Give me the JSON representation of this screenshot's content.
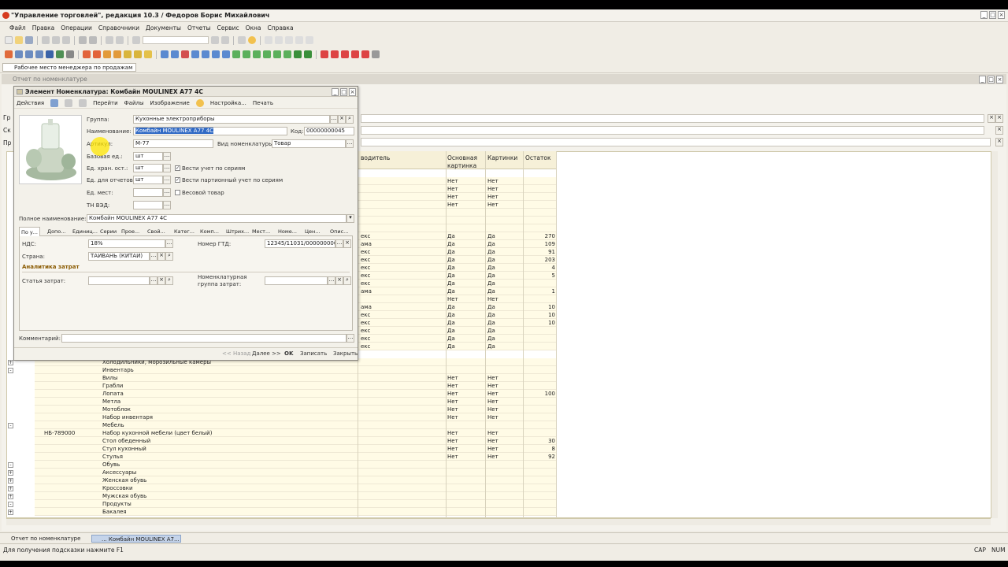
{
  "app": {
    "title": "\"Управление торговлей\", редакция 10.3 / Федоров Борис Михайлович",
    "window_buttons": [
      "_",
      "□",
      "×"
    ]
  },
  "menu": [
    "Файл",
    "Правка",
    "Операции",
    "Справочники",
    "Документы",
    "Отчеты",
    "Сервис",
    "Окна",
    "Справка"
  ],
  "panel": {
    "tab_label": "Рабочее место менеджера по продажам"
  },
  "report": {
    "title": "Отчет по номенклатуре",
    "left_labels": [
      "Гр",
      "Ск",
      "Пр"
    ],
    "columns": {
      "producer": "водитель",
      "main_picture": "Основная картинка",
      "pictures": "Картинки",
      "stock": "Остаток"
    },
    "rows_upper": [
      {
        "producer": "",
        "main": "Нет",
        "pics": "Нет",
        "stock": ""
      },
      {
        "producer": "",
        "main": "Нет",
        "pics": "Нет",
        "stock": ""
      },
      {
        "producer": "",
        "main": "Нет",
        "pics": "Нет",
        "stock": ""
      },
      {
        "producer": "",
        "main": "Нет",
        "pics": "Нет",
        "stock": ""
      },
      {
        "producer": "",
        "main": "",
        "pics": "",
        "stock": ""
      },
      {
        "producer": "",
        "main": "",
        "pics": "",
        "stock": ""
      },
      {
        "producer": "",
        "main": "",
        "pics": "",
        "stock": ""
      },
      {
        "producer": "екс",
        "main": "Да",
        "pics": "Да",
        "stock": "270"
      },
      {
        "producer": "ама",
        "main": "Да",
        "pics": "Да",
        "stock": "109"
      },
      {
        "producer": "екс",
        "main": "Да",
        "pics": "Да",
        "stock": "91"
      },
      {
        "producer": "екс",
        "main": "Да",
        "pics": "Да",
        "stock": "203"
      },
      {
        "producer": "екс",
        "main": "Да",
        "pics": "Да",
        "stock": "4"
      },
      {
        "producer": "екс",
        "main": "Да",
        "pics": "Да",
        "stock": "5"
      },
      {
        "producer": "екс",
        "main": "Да",
        "pics": "Да",
        "stock": ""
      },
      {
        "producer": "ама",
        "main": "Да",
        "pics": "Да",
        "stock": "1"
      },
      {
        "producer": "",
        "main": "Нет",
        "pics": "Нет",
        "stock": ""
      },
      {
        "producer": "ама",
        "main": "Да",
        "pics": "Да",
        "stock": "10"
      },
      {
        "producer": "екс",
        "main": "Да",
        "pics": "Да",
        "stock": "10"
      },
      {
        "producer": "екс",
        "main": "Да",
        "pics": "Да",
        "stock": "10"
      },
      {
        "producer": "екс",
        "main": "Да",
        "pics": "Да",
        "stock": ""
      },
      {
        "producer": "екс",
        "main": "Да",
        "pics": "Да",
        "stock": ""
      },
      {
        "producer": "екс",
        "main": "Да",
        "pics": "Да",
        "stock": ""
      }
    ],
    "rows_lower": [
      {
        "code": "",
        "name": "Холодильники, морозильные камеры",
        "main": "",
        "pics": "",
        "stock": "",
        "tree": "+"
      },
      {
        "code": "",
        "name": "Инвентарь",
        "main": "",
        "pics": "",
        "stock": "",
        "tree": "-"
      },
      {
        "code": "",
        "name": "Вилы",
        "main": "Нет",
        "pics": "Нет",
        "stock": "",
        "tree": ""
      },
      {
        "code": "",
        "name": "Грабли",
        "main": "Нет",
        "pics": "Нет",
        "stock": "",
        "tree": ""
      },
      {
        "code": "",
        "name": "Лопата",
        "main": "Нет",
        "pics": "Нет",
        "stock": "100",
        "tree": ""
      },
      {
        "code": "",
        "name": "Метла",
        "main": "Нет",
        "pics": "Нет",
        "stock": "",
        "tree": ""
      },
      {
        "code": "",
        "name": "Мотоблок",
        "main": "Нет",
        "pics": "Нет",
        "stock": "",
        "tree": ""
      },
      {
        "code": "",
        "name": "Набор инвентаря",
        "main": "Нет",
        "pics": "Нет",
        "stock": "",
        "tree": ""
      },
      {
        "code": "",
        "name": "Мебель",
        "main": "",
        "pics": "",
        "stock": "",
        "tree": "-"
      },
      {
        "code": "НБ-789000",
        "name": "Набор кухонной мебели (цвет белый)",
        "main": "Нет",
        "pics": "Нет",
        "stock": "",
        "tree": ""
      },
      {
        "code": "",
        "name": "Стол обеденный",
        "main": "Нет",
        "pics": "Нет",
        "stock": "30",
        "tree": ""
      },
      {
        "code": "",
        "name": "Стул кухонный",
        "main": "Нет",
        "pics": "Нет",
        "stock": "8",
        "tree": ""
      },
      {
        "code": "",
        "name": "Стулья",
        "main": "Нет",
        "pics": "Нет",
        "stock": "92",
        "tree": ""
      },
      {
        "code": "",
        "name": "Обувь",
        "main": "",
        "pics": "",
        "stock": "",
        "tree": "-"
      },
      {
        "code": "",
        "name": "Аксессуары",
        "main": "",
        "pics": "",
        "stock": "",
        "tree": "+"
      },
      {
        "code": "",
        "name": "Женская обувь",
        "main": "",
        "pics": "",
        "stock": "",
        "tree": "+"
      },
      {
        "code": "",
        "name": "Кроссовки",
        "main": "",
        "pics": "",
        "stock": "",
        "tree": "+"
      },
      {
        "code": "",
        "name": "Мужская обувь",
        "main": "",
        "pics": "",
        "stock": "",
        "tree": "+"
      },
      {
        "code": "",
        "name": "Продукты",
        "main": "",
        "pics": "",
        "stock": "",
        "tree": "-"
      },
      {
        "code": "",
        "name": "Бакалея",
        "main": "",
        "pics": "",
        "stock": "",
        "tree": "+"
      }
    ]
  },
  "dialog": {
    "title": "Элемент Номенклатура: Комбайн MOULINEX A77 4C",
    "toolbar": {
      "actions": "Действия",
      "goto": "Перейти",
      "files": "Файлы",
      "image": "Изображение",
      "settings": "Настройка...",
      "print": "Печать"
    },
    "fields": {
      "group_label": "Группа:",
      "group_value": "Кухонные электроприборы",
      "name_label": "Наименование:",
      "name_value": "Комбайн MOULINEX A77 4C",
      "code_label": "Код:",
      "code_value": "00000000045",
      "article_label": "Артикул:",
      "article_value": "М-77",
      "type_label": "Вид номенклатуры:",
      "type_value": "Товар",
      "base_unit_label": "Базовая ед.:",
      "base_unit_value": "шт",
      "storage_unit_label": "Ед. хран. ост.:",
      "storage_unit_value": "шт",
      "report_unit_label": "Ед. для отчетов:",
      "report_unit_value": "шт",
      "place_unit_label": "Ед. мест:",
      "place_unit_value": "",
      "tnved_label": "ТН ВЭД:",
      "tnved_value": "",
      "series_check": "Вести учет по сериям",
      "batch_check": "Вести партионный учет по сериям",
      "weight_check": "Весовой товар",
      "full_name_label": "Полное наименование:",
      "full_name_value": "Комбайн MOULINEX A77 4C"
    },
    "tabs": [
      "По у...",
      "Допо...",
      "Единиц...",
      "Серии",
      "Прое...",
      "Свой...",
      "Катег...",
      "Комп...",
      "Штрих...",
      "Мест...",
      "Номе...",
      "Цен...",
      "Опис..."
    ],
    "tab_content": {
      "vat_label": "НДС:",
      "vat_value": "18%",
      "gtd_label": "Номер ГТД:",
      "gtd_value": "12345/11031/000000000",
      "country_label": "Страна:",
      "country_value": "ТАЙВАНЬ (КИТАЙ)",
      "analytics_header": "Аналитика затрат",
      "cost_item_label": "Статья затрат:",
      "cost_item_value": "",
      "nom_group_label": "Номенклатурная группа затрат:",
      "nom_group_value": ""
    },
    "comment_label": "Комментарий:",
    "footer": {
      "back": "<< Назад",
      "next": "Далее >>",
      "ok": "OK",
      "save": "Записать",
      "close": "Закрыть"
    }
  },
  "taskbar": {
    "items": [
      "Отчет по номенклатуре",
      "... Комбайн MOULINEX A7..."
    ]
  },
  "status": {
    "hint": "Для получения подсказки нажмите F1",
    "caps": "CAP",
    "num": "NUM"
  },
  "colors": {
    "accent": "#ffe600",
    "row_fill": "#fffbe6",
    "dialog_bg": "#f3f1ea",
    "app_icon": "#d63b1f"
  }
}
